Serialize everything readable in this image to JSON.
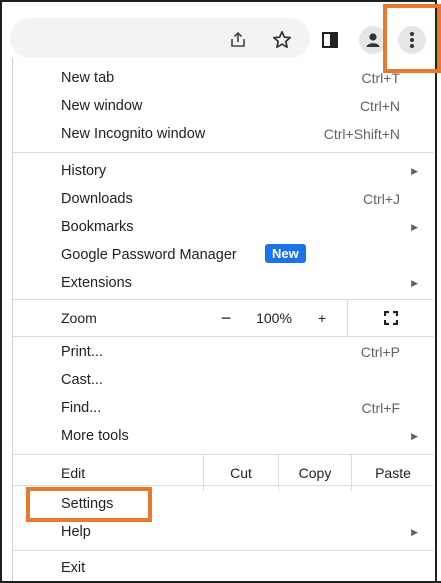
{
  "toolbar": {
    "icons": [
      "share-icon",
      "star-icon",
      "side-panel-icon",
      "profile-icon",
      "more-vert-icon"
    ]
  },
  "menu": {
    "group1": [
      {
        "label": "New tab",
        "shortcut": "Ctrl+T"
      },
      {
        "label": "New window",
        "shortcut": "Ctrl+N"
      },
      {
        "label": "New Incognito window",
        "shortcut": "Ctrl+Shift+N"
      }
    ],
    "group2": [
      {
        "label": "History",
        "shortcut": "",
        "submenu": true
      },
      {
        "label": "Downloads",
        "shortcut": "Ctrl+J"
      },
      {
        "label": "Bookmarks",
        "shortcut": "",
        "submenu": true
      },
      {
        "label": "Google Password Manager",
        "badge": "New"
      },
      {
        "label": "Extensions",
        "shortcut": "",
        "submenu": true
      }
    ],
    "zoom": {
      "label": "Zoom",
      "minus": "−",
      "value": "100%",
      "plus": "+"
    },
    "group3": [
      {
        "label": "Print...",
        "shortcut": "Ctrl+P"
      },
      {
        "label": "Cast...",
        "shortcut": ""
      },
      {
        "label": "Find...",
        "shortcut": "Ctrl+F"
      },
      {
        "label": "More tools",
        "shortcut": "",
        "submenu": true
      }
    ],
    "edit": {
      "label": "Edit",
      "cut": "Cut",
      "copy": "Copy",
      "paste": "Paste"
    },
    "group4": [
      {
        "label": "Settings"
      },
      {
        "label": "Help",
        "submenu": true
      }
    ],
    "exit": {
      "label": "Exit"
    }
  },
  "highlight_color": "#e8792b",
  "badge_color": "#1a73e8"
}
